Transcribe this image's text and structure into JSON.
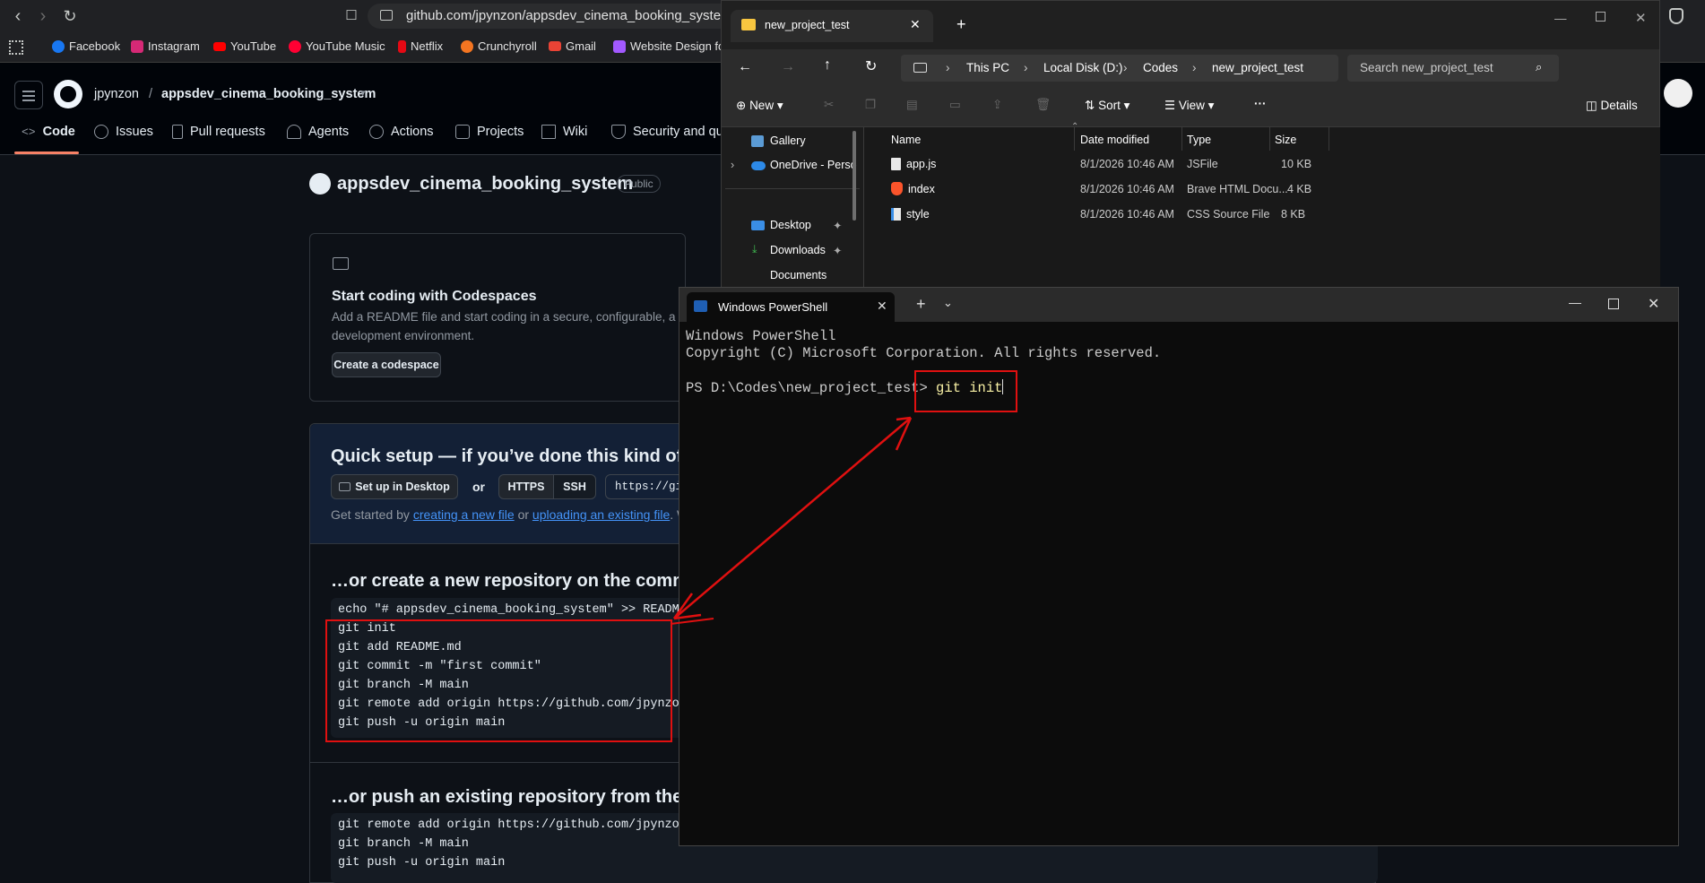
{
  "browser": {
    "url": "github.com/jpynzon/appsdev_cinema_booking_system",
    "bookmarks": [
      "Facebook",
      "Instagram",
      "YouTube",
      "YouTube Music",
      "Netflix",
      "Crunchyroll",
      "Gmail",
      "Website Design for"
    ]
  },
  "github": {
    "owner": "jpynzon",
    "separator": "/",
    "repo": "appsdev_cinema_booking_system",
    "visibility": "Public",
    "tabs": [
      "Code",
      "Issues",
      "Pull requests",
      "Agents",
      "Actions",
      "Projects",
      "Wiki",
      "Security and qu"
    ],
    "codespaces": {
      "title": "Start coding with Codespaces",
      "desc_line1": "Add a README file and start coding in a secure, configurable, a",
      "desc_line2": "development environment.",
      "button": "Create a codespace"
    },
    "quick_setup": {
      "title": "Quick setup — if you’ve done this kind of t",
      "desktop_button": "Set up in Desktop",
      "or": "or",
      "https": "HTTPS",
      "ssh": "SSH",
      "clone_url": "https://git",
      "get_started_prefix": "Get started by",
      "link_new_file": "creating a new file",
      "or2": "or",
      "link_upload": "uploading an existing file",
      "suffix": ". W"
    },
    "create_section": {
      "title": "…or create a new repository on the comma",
      "lines": [
        "echo \"# appsdev_cinema_booking_system\" >> README.m",
        "git init",
        "git add README.md",
        "git commit -m \"first commit\"",
        "git branch -M main",
        "git remote add origin https://github.com/jpynzon/a",
        "git push -u origin main"
      ]
    },
    "push_section": {
      "title": "…or push an existing repository from the c",
      "lines": [
        "git remote add origin https://github.com/jpynzon/a",
        "git branch -M main",
        "git push -u origin main"
      ]
    }
  },
  "explorer": {
    "tab_title": "new_project_test",
    "breadcrumb": [
      "This PC",
      "Local Disk (D:)",
      "Codes",
      "new_project_test"
    ],
    "search_placeholder": "Search new_project_test",
    "toolbar": {
      "new": "New",
      "sort": "Sort",
      "view": "View",
      "more": "···",
      "details": "Details"
    },
    "sidebar": [
      "Gallery",
      "OneDrive - Perso",
      "Desktop",
      "Downloads",
      "Documents"
    ],
    "columns": [
      "Name",
      "Date modified",
      "Type",
      "Size"
    ],
    "files": [
      {
        "name": "app.js",
        "date": "8/1/2026 10:46 AM",
        "type": "JSFile",
        "size": "10 KB"
      },
      {
        "name": "index",
        "date": "8/1/2026 10:46 AM",
        "type": "Brave HTML Docu...",
        "size": "4 KB"
      },
      {
        "name": "style",
        "date": "8/1/2026 10:46 AM",
        "type": "CSS Source File",
        "size": "8 KB"
      }
    ]
  },
  "powershell": {
    "tab_title": "Windows PowerShell",
    "line1": "Windows PowerShell",
    "line2": "Copyright (C) Microsoft Corporation. All rights reserved.",
    "prompt": "PS D:\\Codes\\new_project_test> ",
    "command": "git init"
  },
  "colors": {
    "annotation": "#e01010",
    "link": "#4493f8",
    "gh_bg": "#0d1117",
    "terminal_bg": "#0c0c0c"
  }
}
